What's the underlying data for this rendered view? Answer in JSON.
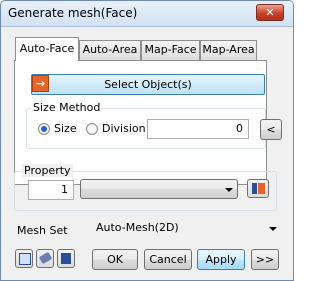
{
  "window": {
    "title": "Generate mesh(Face)",
    "close_glyph": "✕"
  },
  "tabs": [
    "Auto-Face",
    "Auto-Area",
    "Map-Face",
    "Map-Area"
  ],
  "select_objects": {
    "label": "Select Object(s)"
  },
  "size_method": {
    "group_label": "Size Method",
    "options": [
      "Size",
      "Division"
    ],
    "selected": "Size",
    "value": "0",
    "pick_button": "<"
  },
  "property": {
    "group_label": "Property",
    "number": "1",
    "selected": ""
  },
  "mesh_set": {
    "label": "Mesh Set",
    "value": "Auto-Mesh(2D)"
  },
  "buttons": {
    "ok": "OK",
    "cancel": "Cancel",
    "apply": "Apply",
    "more": ">>"
  },
  "colors": {
    "accent": "#1f62c9",
    "select_icon": "#e8632a",
    "close": "#c9432b"
  }
}
